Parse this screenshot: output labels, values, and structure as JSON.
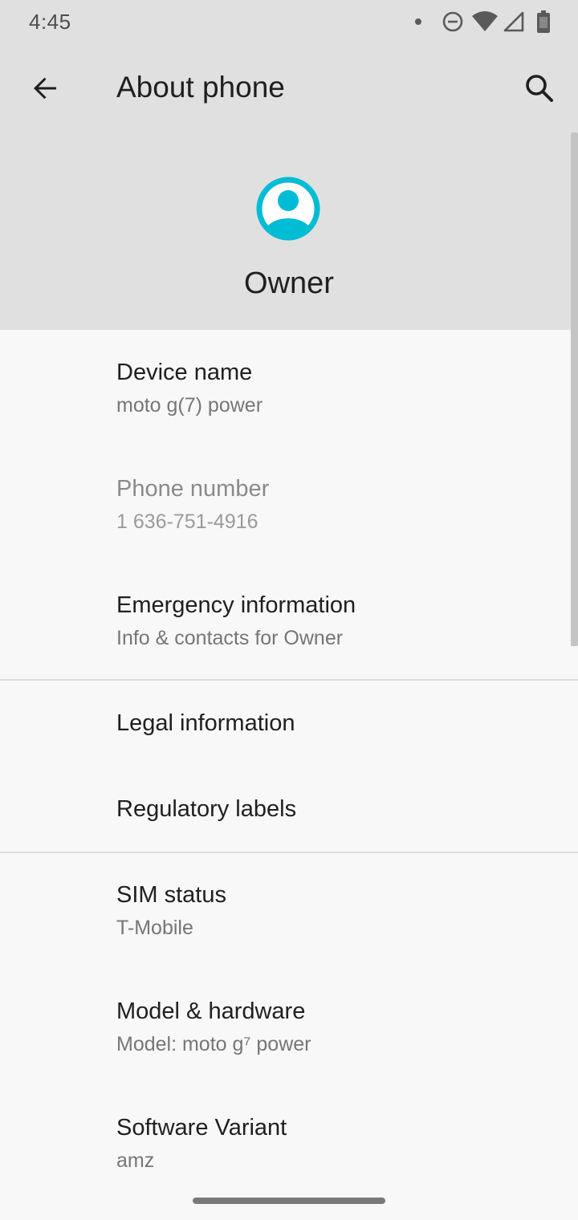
{
  "status_bar": {
    "time": "4:45",
    "icons": [
      "notification-dot-icon",
      "do-not-disturb-icon",
      "wifi-icon",
      "cell-signal-icon",
      "battery-icon"
    ]
  },
  "toolbar": {
    "title": "About phone",
    "back_icon": "arrow-back-icon",
    "search_icon": "search-icon"
  },
  "profile": {
    "name": "Owner",
    "avatar_icon": "account-circle-icon",
    "accent_color": "#00bcd4"
  },
  "items": [
    {
      "title": "Device name",
      "summary": "moto g(7) power"
    },
    {
      "title": "Phone number",
      "summary": "1 636-751-4916"
    },
    {
      "title": "Emergency information",
      "summary": "Info & contacts for Owner"
    },
    {
      "title": "Legal information"
    },
    {
      "title": "Regulatory labels"
    },
    {
      "title": "SIM status",
      "summary": "T-Mobile"
    },
    {
      "title": "Model & hardware",
      "summary": "Model: moto g⁷ power"
    },
    {
      "title": "Software Variant",
      "summary": "amz"
    }
  ]
}
